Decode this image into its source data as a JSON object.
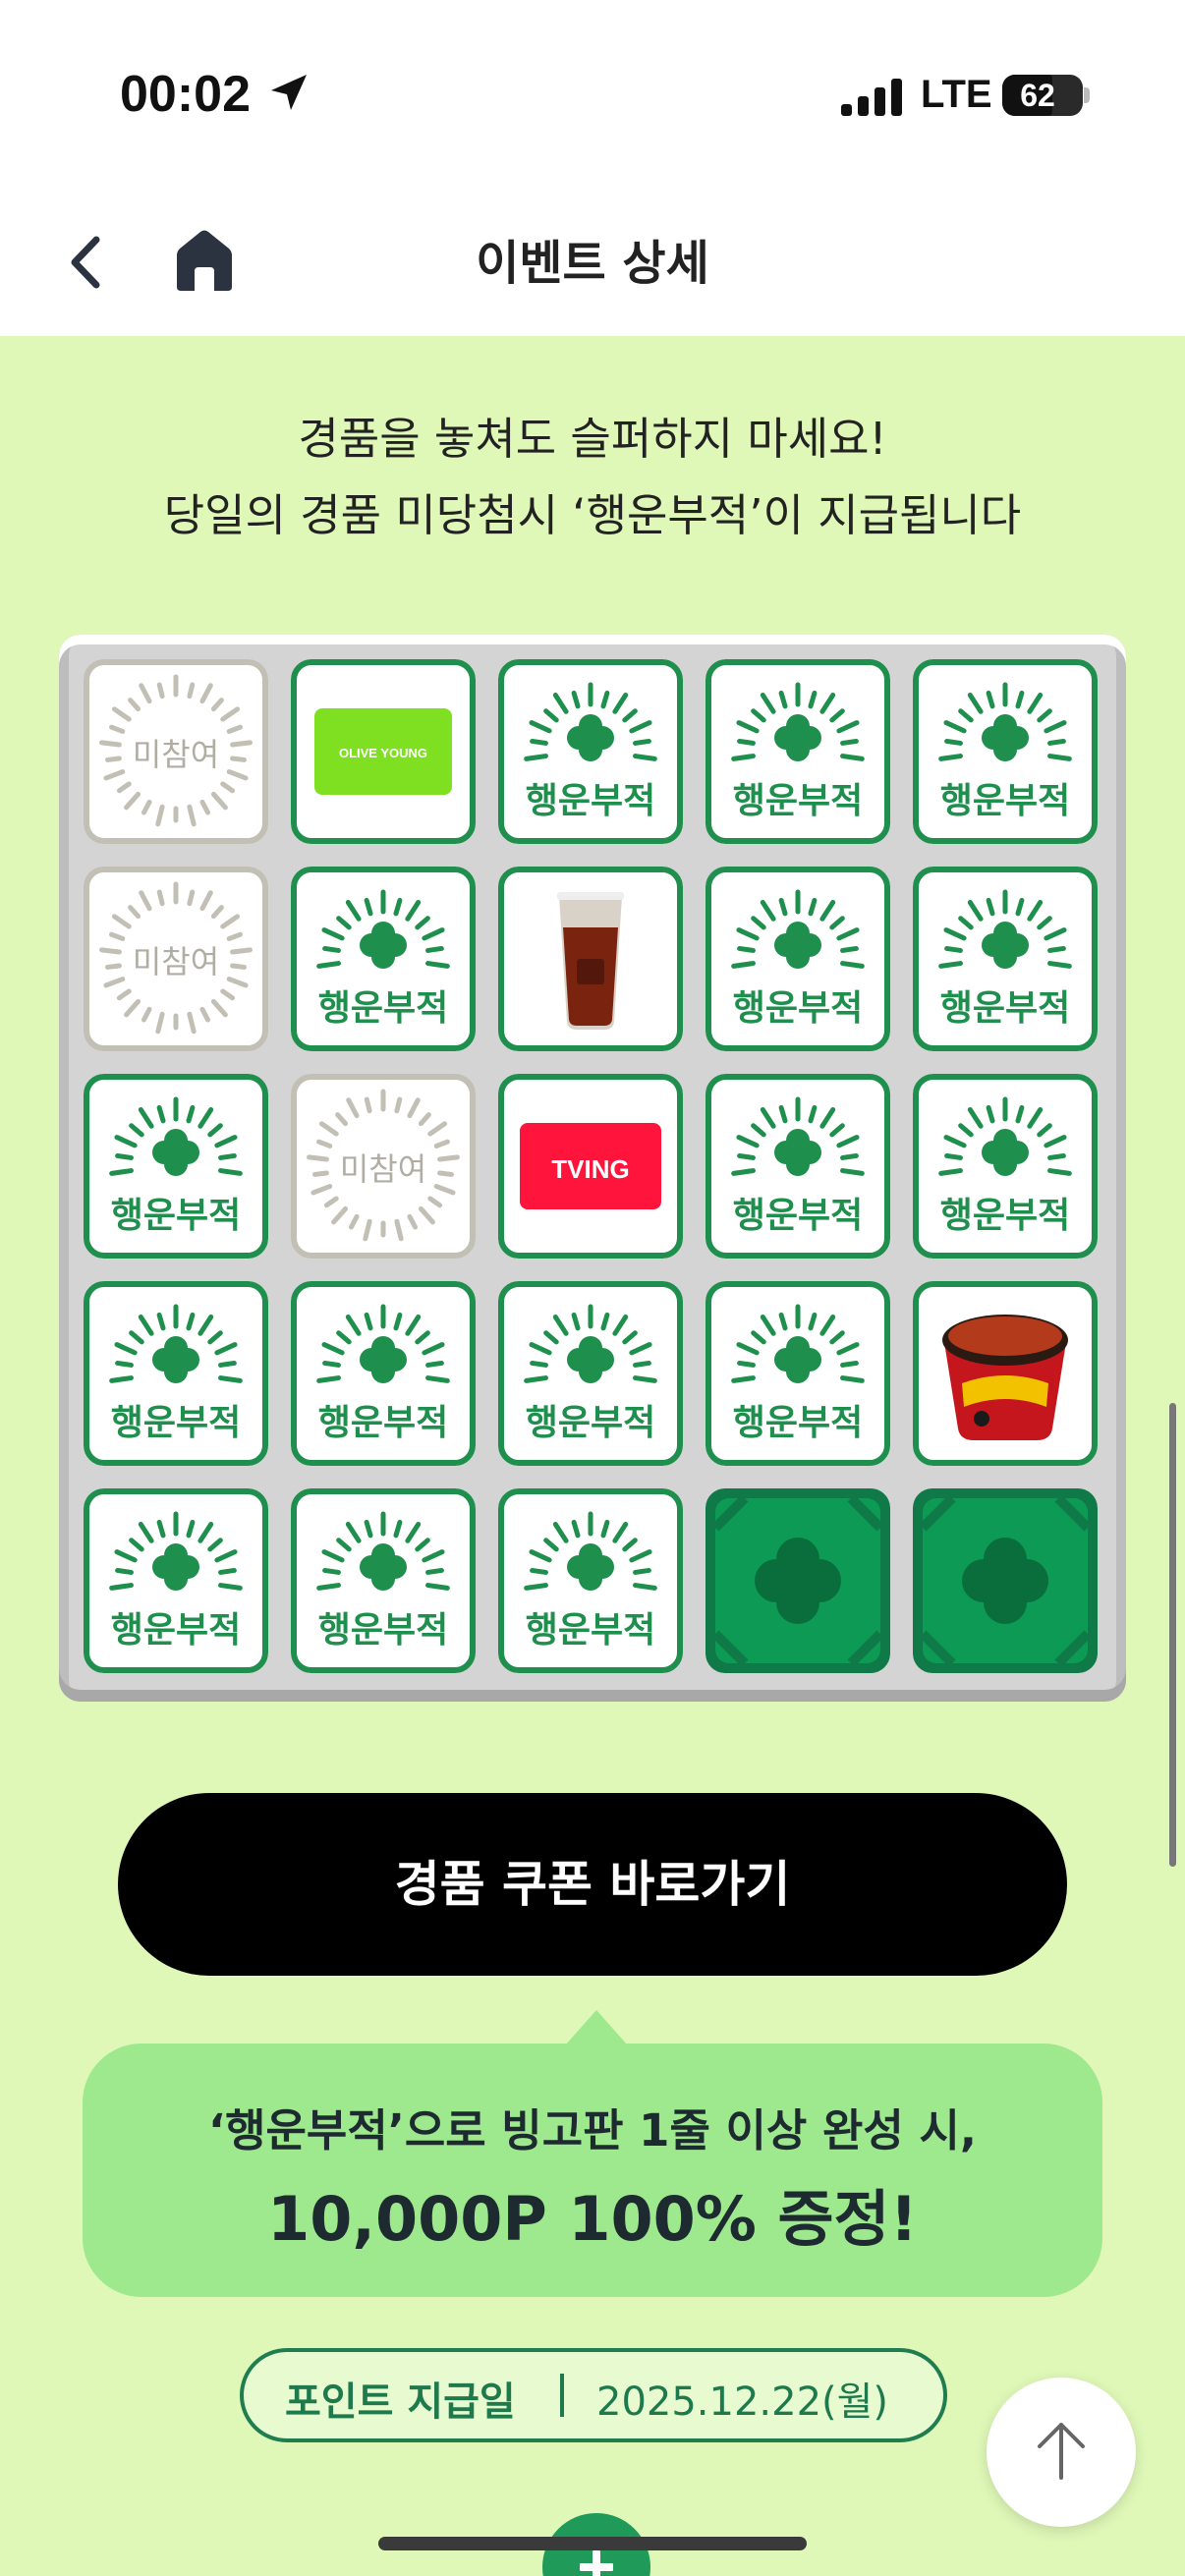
{
  "status_bar": {
    "time": "00:02",
    "network": "LTE",
    "battery": "62",
    "battery_level": 0.62,
    "location_icon": "location-arrow-icon",
    "signal_icon": "cellular-signal-icon"
  },
  "nav": {
    "title": "이벤트 상세",
    "back_icon": "chevron-left-icon",
    "home_icon": "home-icon"
  },
  "intro": {
    "line1": "경품을 놓쳐도 슬퍼하지 마세요!",
    "line2": "당일의 경품 미당첨시 ‘행운부적’이 지급됩니다"
  },
  "board": {
    "cell_labels": {
      "missed": "미참여",
      "charm": "행운부적",
      "olive": "OLIVE YOUNG",
      "tving": "TVING"
    },
    "rows": [
      [
        "missed",
        "olive",
        "charm",
        "charm",
        "charm"
      ],
      [
        "missed",
        "charm",
        "drink",
        "charm",
        "charm"
      ],
      [
        "charm",
        "missed",
        "tving",
        "charm",
        "charm"
      ],
      [
        "charm",
        "charm",
        "charm",
        "charm",
        "noodle"
      ],
      [
        "charm",
        "charm",
        "charm",
        "closed",
        "closed"
      ]
    ],
    "colors": {
      "charm_green": "#1f8f4e",
      "missed_gray": "#c2bfb5",
      "olive_green": "#7ee020",
      "tving_red": "#ff153c",
      "closed_green": "#0f7a47"
    }
  },
  "coupon_button": {
    "label": "경품 쿠폰 바로가기"
  },
  "bubble": {
    "line1": "‘행운부적’으로 빙고판 1줄 이상 완성 시,",
    "line2": "10,000P 100% 증정!"
  },
  "payout": {
    "label": "포인트 지급일",
    "date": "2025.12.22(월)"
  },
  "scroll_top": {
    "icon": "arrow-up-icon"
  }
}
